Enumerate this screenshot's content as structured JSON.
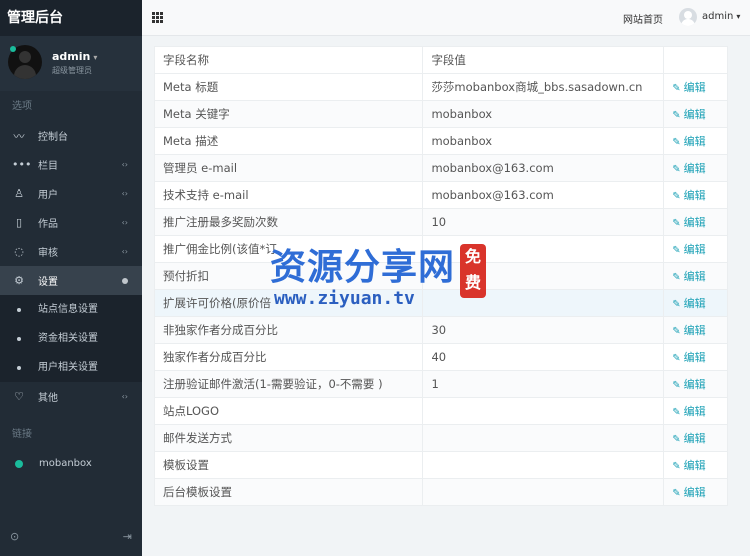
{
  "sidebar": {
    "brand": "管理后台",
    "user": {
      "name": "admin",
      "role": "超级管理员"
    },
    "section_options": "选项",
    "section_links": "链接",
    "menu": [
      {
        "label": "控制台",
        "icon": "chart-line-icon",
        "glyph": "〰",
        "arrow": ""
      },
      {
        "label": "栏目",
        "icon": "dots-icon",
        "glyph": "•••",
        "arrow": "‹›"
      },
      {
        "label": "用户",
        "icon": "user-icon",
        "glyph": "♙",
        "arrow": "‹›"
      },
      {
        "label": "作品",
        "icon": "works-icon",
        "glyph": "▯",
        "arrow": "‹›"
      },
      {
        "label": "审核",
        "icon": "spinner-icon",
        "glyph": "◌",
        "arrow": "‹›"
      }
    ],
    "settings": {
      "label": "设置",
      "icon": "gear-icon",
      "glyph": "⚙"
    },
    "submenu": [
      "站点信息设置",
      "资金相关设置",
      "用户相关设置"
    ],
    "other": {
      "label": "其他",
      "icon": "bulb-icon",
      "glyph": "♡",
      "arrow": "‹›"
    },
    "link": "mobanbox",
    "footer_left": "⊙",
    "footer_right": "⇥"
  },
  "topbar": {
    "home_link": "网站首页",
    "user": "admin"
  },
  "table": {
    "headers": [
      "字段名称",
      "字段值",
      ""
    ],
    "edit_label": "编辑",
    "rows": [
      {
        "name": "Meta 标题",
        "value": "莎莎mobanbox商城_bbs.sasadown.cn"
      },
      {
        "name": "Meta 关键字",
        "value": "mobanbox"
      },
      {
        "name": "Meta 描述",
        "value": "mobanbox"
      },
      {
        "name": "管理员 e-mail",
        "value": "mobanbox@163.com"
      },
      {
        "name": "技术支持 e-mail",
        "value": "mobanbox@163.com"
      },
      {
        "name": "推广注册最多奖励次数",
        "value": "10"
      },
      {
        "name": "推广佣金比例(该值*订",
        "value": ""
      },
      {
        "name": "预付折扣",
        "value": ""
      },
      {
        "name": "扩展许可价格(原价倍",
        "value": ""
      },
      {
        "name": "非独家作者分成百分比",
        "value": "30"
      },
      {
        "name": "独家作者分成百分比",
        "value": "40"
      },
      {
        "name": "注册验证邮件激活(1-需要验证，0-不需要 )",
        "value": "1"
      },
      {
        "name": "站点LOGO",
        "value": ""
      },
      {
        "name": "邮件发送方式",
        "value": ""
      },
      {
        "name": "模板设置",
        "value": ""
      },
      {
        "name": "后台模板设置",
        "value": ""
      }
    ]
  },
  "watermark": {
    "title": "资源分享网",
    "url": "www.ziyuan.tv",
    "badge": "免费"
  },
  "colors": {
    "sidebar_bg": "#222c36",
    "accent": "#1aa0b5",
    "online": "#1abc9c"
  }
}
